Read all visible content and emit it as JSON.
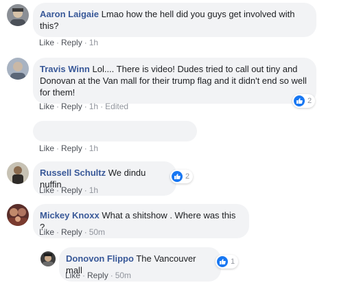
{
  "comments": [
    {
      "author": "Aaron Laigaie",
      "text": "Lmao how the hell did you guys get involved with this?",
      "actions": {
        "like": "Like",
        "reply": "Reply",
        "time": "1h"
      }
    },
    {
      "author": "Travis Winn",
      "text": "Lol.... There is video! Dudes tried to call out tiny and Donovan at the Van mall for their trump flag and it didn't end so well for them!",
      "actions": {
        "like": "Like",
        "reply": "Reply",
        "time": "1h",
        "edited": "Edited"
      },
      "reaction_count": "2"
    },
    {
      "actions": {
        "like": "Like",
        "reply": "Reply",
        "time": "1h"
      }
    },
    {
      "author": "Russell Schultz",
      "text": "We dindu nuffin",
      "actions": {
        "like": "Like",
        "reply": "Reply",
        "time": "1h"
      },
      "reaction_count": "2"
    },
    {
      "author": "Mickey Knoxx",
      "text": "What a shitshow . Where was this ?",
      "actions": {
        "like": "Like",
        "reply": "Reply",
        "time": "50m"
      }
    },
    {
      "author": "Donovon Flippo",
      "text": "The Vancouver mall",
      "actions": {
        "like": "Like",
        "reply": "Reply",
        "time": "50m"
      },
      "reaction_count": "1"
    }
  ],
  "separator": "·",
  "colors": {
    "author": "#385898",
    "bubble": "#f2f3f5",
    "like_badge": "#1877f2"
  },
  "icons": {
    "reaction": "thumbs-up-icon"
  }
}
